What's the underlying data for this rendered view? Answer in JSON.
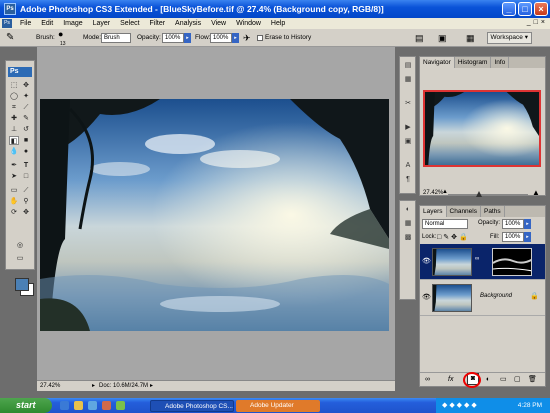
{
  "window": {
    "title": "Adobe Photoshop CS3 Extended - [BlueSkyBefore.tif @ 27.4% (Background copy, RGB/8)]"
  },
  "menu": [
    "File",
    "Edit",
    "Image",
    "Layer",
    "Select",
    "Filter",
    "Analysis",
    "View",
    "Window",
    "Help"
  ],
  "options": {
    "brush_label": "Brush:",
    "brush_size": "13",
    "mode_label": "Mode:",
    "mode_value": "Brush",
    "opacity_label": "Opacity:",
    "opacity_value": "100%",
    "flow_label": "Flow:",
    "flow_value": "100%",
    "erase_history": "Erase to History",
    "workspace": "Workspace"
  },
  "toolbox": {
    "logo": "Ps"
  },
  "status": {
    "zoom": "27.42%",
    "doc": "Doc: 10.6M/24.7M"
  },
  "navigator": {
    "tabs": [
      "Navigator",
      "Histogram",
      "Info"
    ],
    "zoom": "27.42%"
  },
  "layers": {
    "tabs": [
      "Layers",
      "Channels",
      "Paths"
    ],
    "blend_mode": "Normal",
    "opacity_label": "Opacity:",
    "opacity_value": "100%",
    "lock_label": "Lock:",
    "fill_label": "Fill:",
    "fill_value": "100%",
    "items": [
      {
        "name": ""
      },
      {
        "name": "Background"
      }
    ]
  },
  "taskbar": {
    "start": "start",
    "tasks": [
      "Adobe Photoshop CS...",
      "Adobe Updater"
    ],
    "clock": "4:28 PM"
  }
}
